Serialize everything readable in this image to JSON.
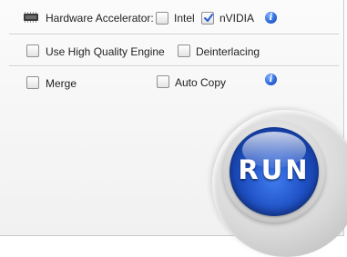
{
  "options": {
    "hardware_accelerator_label": "Hardware Accelerator:",
    "intel": {
      "label": "Intel",
      "checked": false
    },
    "nvidia": {
      "label": "nVIDIA",
      "checked": true
    },
    "use_high_quality_engine": {
      "label": "Use High Quality Engine",
      "checked": false
    },
    "deinterlacing": {
      "label": "Deinterlacing",
      "checked": false
    },
    "merge": {
      "label": "Merge",
      "checked": false
    },
    "auto_copy": {
      "label": "Auto Copy",
      "checked": false
    }
  },
  "run_button": {
    "label": "RUN"
  },
  "icons": {
    "hardware": "gpu-chip-icon",
    "info": "info-icon"
  },
  "colors": {
    "accent_blue": "#1e4fc2",
    "check_blue": "#2a5fd0"
  }
}
